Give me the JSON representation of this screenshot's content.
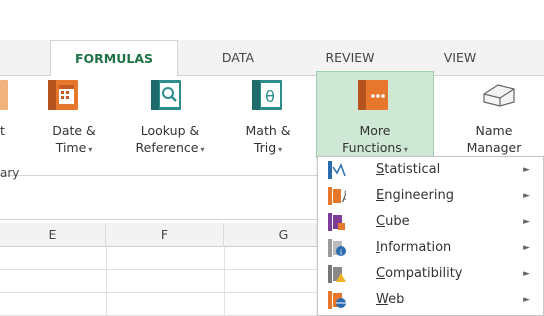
{
  "tabs": [
    {
      "label": "FORMULAS",
      "active": true
    },
    {
      "label": "DATA",
      "active": false
    },
    {
      "label": "REVIEW",
      "active": false
    },
    {
      "label": "VIEW",
      "active": false
    }
  ],
  "ribbon": {
    "partial_label_1": "t",
    "date_time": {
      "line1": "Date &",
      "line2": "Time"
    },
    "lookup_reference": {
      "line1": "Lookup &",
      "line2": "Reference"
    },
    "math_trig": {
      "line1": "Math &",
      "line2": "Trig"
    },
    "more_functions": {
      "line1": "More",
      "line2": "Functions"
    },
    "name_manager": {
      "line1": "Name",
      "line2": "Manager"
    },
    "group_label": "ary"
  },
  "columns": [
    "E",
    "F",
    "G"
  ],
  "menu": {
    "items": [
      {
        "key": "S",
        "rest": "tatistical"
      },
      {
        "key": "E",
        "rest": "ngineering"
      },
      {
        "key": "C",
        "rest": "ube"
      },
      {
        "key": "I",
        "rest": "nformation"
      },
      {
        "key": "C",
        "rest": "ompatibility"
      },
      {
        "key": "W",
        "rest": "eb"
      }
    ]
  },
  "colors": {
    "accent_green": "#217346",
    "highlight": "#cfe8d5",
    "icon_orange": "#e8772e",
    "icon_teal": "#2d8c8c",
    "icon_purple": "#7d3c98",
    "icon_blue": "#2b6cb0"
  }
}
